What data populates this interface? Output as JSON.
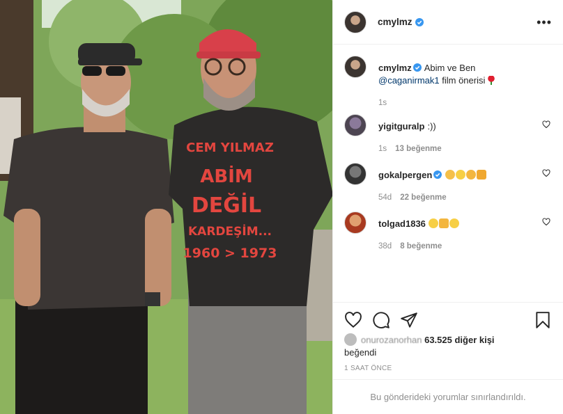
{
  "post": {
    "author": "cmylmz",
    "more_label": "•••",
    "caption": {
      "username": "cmylmz",
      "text": "Abim ve Ben",
      "mention": "@caganirmak1",
      "text_after": "film önerisi",
      "emoji": "rose-emoji",
      "time": "1s"
    },
    "photo": {
      "shirt_text": [
        "CEM YILMAZ",
        "ABİM",
        "DEĞİL",
        "KARDEŞİM...",
        "1960 > 1973"
      ]
    }
  },
  "comments": [
    {
      "username": "yigitguralp",
      "text": ":))",
      "time": "1s",
      "likes": "13 beğenme"
    },
    {
      "username": "gokalpergen",
      "text": "",
      "emojis": [
        "clap-emoji",
        "grin-emoji",
        "fist-emoji",
        "beer-emoji"
      ],
      "time": "54d",
      "likes": "22 beğenme"
    },
    {
      "username": "tolgad1836",
      "text": "",
      "emojis": [
        "sunglasses-emoji",
        "thumbs-up-emoji",
        "heart-eyes-emoji"
      ],
      "time": "38d",
      "likes": "8 beğenme"
    }
  ],
  "actions": {
    "icons": [
      "heart-icon",
      "comment-icon",
      "share-icon",
      "bookmark-icon"
    ]
  },
  "likes": {
    "liker": "onurozanorhan",
    "count_text": "63.525 diğer kişi",
    "suffix": "beğendi"
  },
  "timestamp": "1 SAAT ÖNCE",
  "restricted_text": "Bu gönderideki yorumlar sınırlandırıldı.",
  "colors": {
    "verified": "#3897f0",
    "mention": "#00376b",
    "muted": "#8e8e8e",
    "border": "#efefef"
  }
}
